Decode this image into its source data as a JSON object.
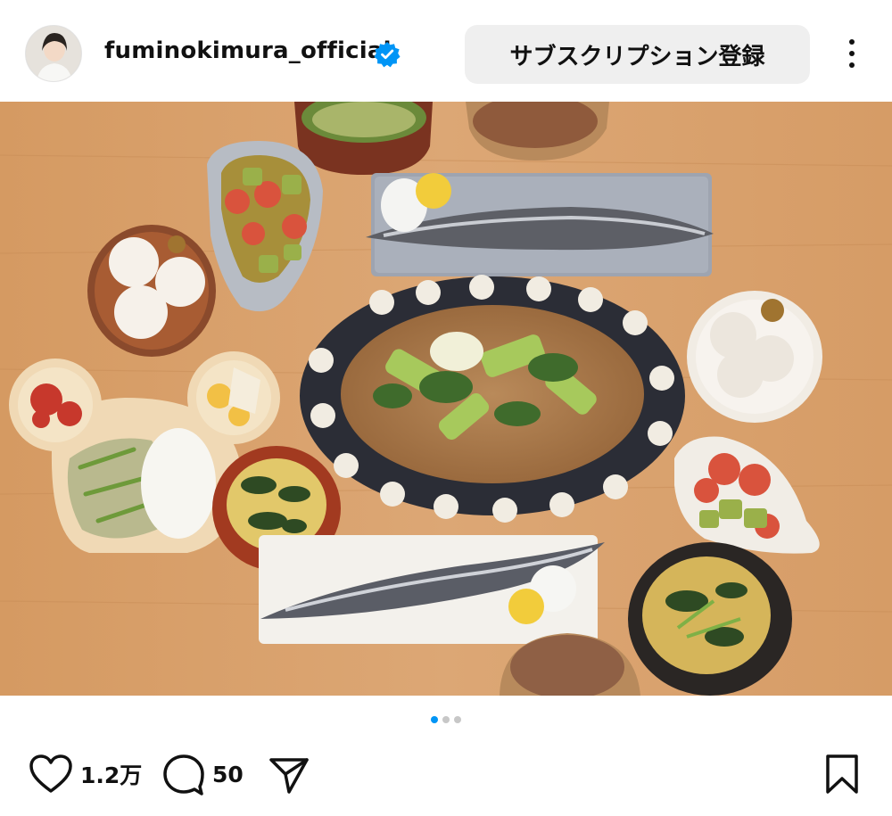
{
  "header": {
    "username": "fuminokimura_official",
    "verified_icon": "verified-badge-icon",
    "subscribe_label": "サブスクリプション登録",
    "more_icon": "more-options-icon"
  },
  "post": {
    "image_alt": "Dinner table spread with saltwater fish, noodles and vegetables"
  },
  "carousel": {
    "total": 3,
    "active": 1
  },
  "actions": {
    "like_count": "1.2万",
    "comment_count": "50",
    "icons": [
      "heart-icon",
      "comment-icon",
      "share-icon",
      "bookmark-icon"
    ]
  },
  "colors": {
    "accent": "#0095f6",
    "verified": "#0095f6",
    "button_bg": "#efefef"
  }
}
